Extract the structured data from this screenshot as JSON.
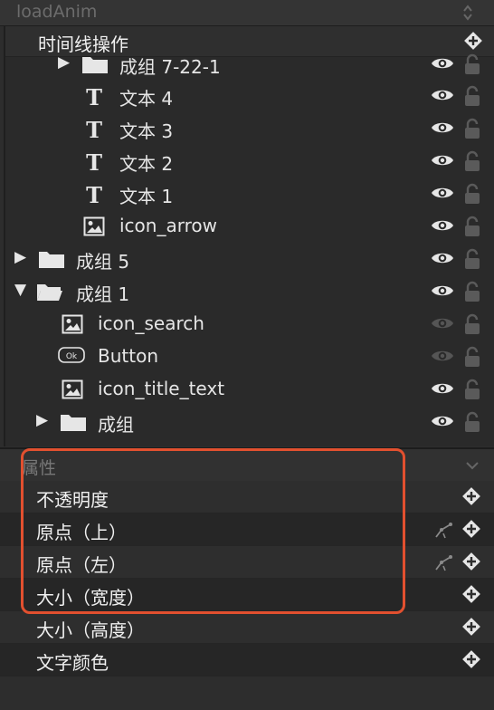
{
  "header": {
    "title": "loadAnim"
  },
  "timeline": {
    "title": "时间线操作"
  },
  "layers": [
    {
      "label": "成组 7-22-1",
      "type": "folder",
      "arrow": "▶",
      "dim_eye": false
    },
    {
      "label": "文本 4",
      "type": "text",
      "dim_eye": false
    },
    {
      "label": "文本 3",
      "type": "text",
      "dim_eye": false
    },
    {
      "label": "文本 2",
      "type": "text",
      "dim_eye": false
    },
    {
      "label": "文本 1",
      "type": "text",
      "dim_eye": false
    },
    {
      "label": "icon_arrow",
      "type": "image",
      "dim_eye": false
    },
    {
      "label": "成组 5",
      "type": "folder",
      "arrow": "▶",
      "dim_eye": false
    },
    {
      "label": "成组 1",
      "type": "folder-open",
      "arrow": "▼",
      "dim_eye": false
    },
    {
      "label": "icon_search",
      "type": "image",
      "dim_eye": true
    },
    {
      "label": "Button",
      "type": "button",
      "badge": "Ok",
      "dim_eye": true
    },
    {
      "label": "icon_title_text",
      "type": "image",
      "dim_eye": false
    },
    {
      "label": "成组",
      "type": "folder",
      "arrow": "▶",
      "dim_eye": false
    }
  ],
  "attributes": {
    "title": "属性",
    "items": [
      {
        "label": "不透明度",
        "ik": false
      },
      {
        "label": "原点（上）",
        "ik": true
      },
      {
        "label": "原点（左）",
        "ik": true
      },
      {
        "label": "大小（宽度）",
        "ik": false
      },
      {
        "label": "大小（高度）",
        "ik": false
      },
      {
        "label": "文字颜色",
        "ik": false
      }
    ]
  },
  "colors": {
    "highlight": "#e2502f",
    "background": "#2d2d2d",
    "text": "#e6e6e6"
  }
}
